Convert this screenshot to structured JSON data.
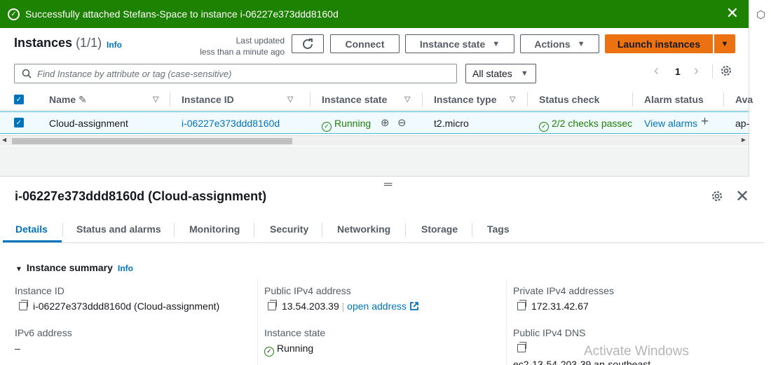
{
  "flash": {
    "message": "Successfully attached Stefans-Space to instance i-06227e373ddd8160d",
    "close": "✕"
  },
  "header": {
    "title": "Instances",
    "count": "(1/1)",
    "info": "Info",
    "last_updated_label": "Last updated",
    "last_updated_value": "less than a minute ago",
    "connect": "Connect",
    "instance_state": "Instance state",
    "actions": "Actions",
    "launch": "Launch instances"
  },
  "filter": {
    "search_placeholder": "Find Instance by attribute or tag (case-sensitive)",
    "state_select": "All states",
    "page": "1"
  },
  "table": {
    "columns": [
      "Name",
      "Instance ID",
      "Instance state",
      "Instance type",
      "Status check",
      "Alarm status",
      "Ava"
    ],
    "rows": [
      {
        "name": "Cloud-assignment",
        "instance_id": "i-06227e373ddd8160d",
        "state": "Running",
        "type": "t2.micro",
        "status_check": "2/2 checks passec",
        "alarm": "View alarms",
        "az": "ap-"
      }
    ]
  },
  "detail": {
    "title": "i-06227e373ddd8160d (Cloud-assignment)",
    "tabs": [
      "Details",
      "Status and alarms",
      "Monitoring",
      "Security",
      "Networking",
      "Storage",
      "Tags"
    ],
    "summary_title": "Instance summary",
    "summary_info": "Info",
    "fields": {
      "instance_id_label": "Instance ID",
      "instance_id_value": "i-06227e373ddd8160d (Cloud-assignment)",
      "ipv6_label": "IPv6 address",
      "ipv6_value": "–",
      "public_ipv4_label": "Public IPv4 address",
      "public_ipv4_value": "13.54.203.39",
      "public_ipv4_sep": "|",
      "open_address": "open address",
      "instance_state_label": "Instance state",
      "instance_state_value": "Running",
      "private_ipv4_label": "Private IPv4 addresses",
      "private_ipv4_value": "172.31.42.67",
      "public_dns_label": "Public IPv4 DNS",
      "public_dns_value": "ec2-13-54-203-39.ap-southeast"
    }
  },
  "watermark": "Activate Windows",
  "colors": {
    "success": "#1d8102",
    "link": "#0073bb",
    "launch": "#ec7211"
  }
}
